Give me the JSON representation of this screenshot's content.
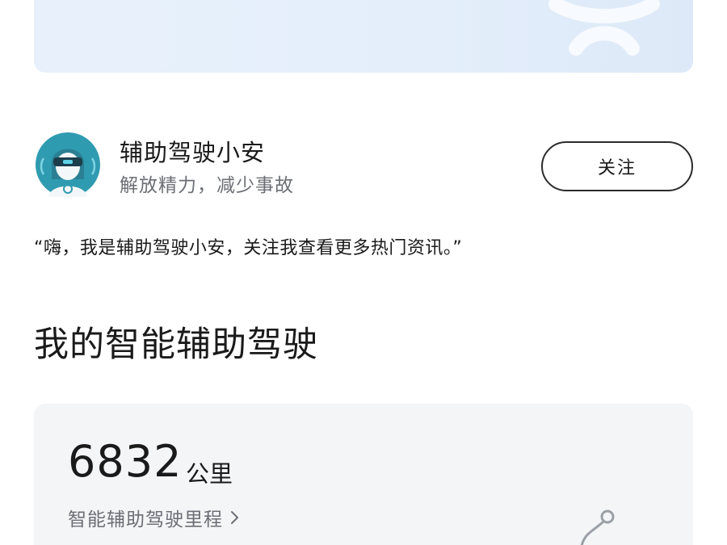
{
  "profile": {
    "name": "辅助驾驶小安",
    "subtitle": "解放精力，减少事故",
    "follow_label": "关注"
  },
  "quote": "“嗨，我是辅助驾驶小安，关注我查看更多热门资讯。”",
  "section": {
    "title": "我的智能辅助驾驶"
  },
  "mileage": {
    "value": "6832",
    "unit": "公里",
    "label": "智能辅助驾驶里程"
  },
  "icons": {
    "avatar": "assistant-avatar-icon",
    "chevron": "chevron-right-icon",
    "route": "route-icon",
    "banner_decoration": "banner-decoration-icon"
  },
  "colors": {
    "banner_bg": "#e4eefb",
    "avatar_bg": "#2f9bb0",
    "card_bg": "#f4f5f7",
    "secondary_text": "#6b6f75"
  }
}
